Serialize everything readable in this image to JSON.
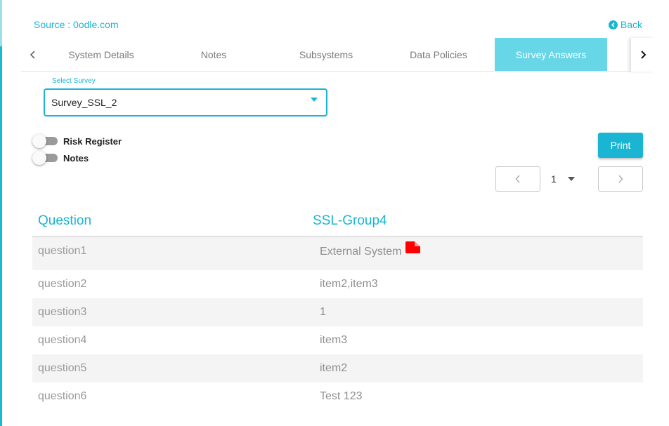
{
  "header": {
    "source": "Source : 0odle.com",
    "back_label": "Back"
  },
  "tabs": [
    {
      "label": "System Details"
    },
    {
      "label": "Notes"
    },
    {
      "label": "Subsystems"
    },
    {
      "label": "Data Policies"
    },
    {
      "label": "Survey Answers",
      "active": true
    }
  ],
  "survey_select": {
    "label": "Select Survey",
    "value": "Survey_SSL_2"
  },
  "toggles": {
    "risk_register": {
      "label": "Risk Register",
      "on": false
    },
    "notes": {
      "label": "Notes",
      "on": false
    }
  },
  "print_label": "Print",
  "pager": {
    "page": "1"
  },
  "table": {
    "headers": {
      "question": "Question",
      "answer": "SSL-Group4"
    },
    "rows": [
      {
        "question": "question1",
        "answer": "External System",
        "icon": "file-icon"
      },
      {
        "question": "question2",
        "answer": "item2,item3"
      },
      {
        "question": "question3",
        "answer": "1"
      },
      {
        "question": "question4",
        "answer": "item3"
      },
      {
        "question": "question5",
        "answer": "item2"
      },
      {
        "question": "question6",
        "answer": "Test 123"
      }
    ]
  },
  "colors": {
    "accent": "#19b5d2",
    "active_tab": "#67d6e6",
    "file_icon": "#ff0000"
  }
}
